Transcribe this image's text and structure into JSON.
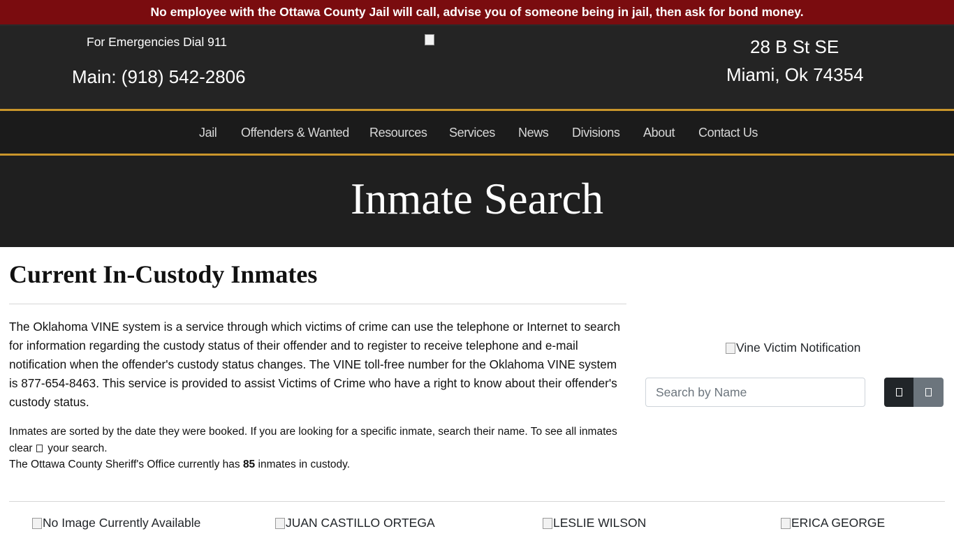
{
  "alert": {
    "text": "No employee with the Ottawa County Jail will call, advise you of someone being in jail, then ask for bond money."
  },
  "header": {
    "emergency": "For Emergencies Dial 911",
    "main_phone": "Main: (918) 542-2806",
    "address_line1": "28 B St SE",
    "address_line2": "Miami, Ok 74354"
  },
  "nav": {
    "items": [
      {
        "label": "Jail"
      },
      {
        "label": "Offenders & Wanted"
      },
      {
        "label": "Resources"
      },
      {
        "label": "Services"
      },
      {
        "label": "News"
      },
      {
        "label": "Divisions"
      },
      {
        "label": "About"
      },
      {
        "label": "Contact Us"
      }
    ]
  },
  "hero": {
    "title": "Inmate Search"
  },
  "main": {
    "section_title": "Current In-Custody Inmates",
    "vine_paragraph": "The Oklahoma VINE system is a service through which victims of crime can use the telephone or Internet to search for information regarding the custody status of their offender and to register to receive telephone and e-mail notification when the offender's custody status changes. The VINE toll-free number for the Oklahoma VINE system is 877-654-8463. This service is provided to assist Victims of Crime who have a right to know about their offender's custody status.",
    "sort_note_a": "Inmates are sorted by the date they were booked. If you are looking for a specific inmate, search their name. To see all inmates clear",
    "sort_note_b": "your search.",
    "count_prefix": "The Ottawa County Sheriff's Office currently has",
    "count": "85",
    "count_suffix": "inmates in custody."
  },
  "sidebar": {
    "vine_image_alt": "Vine Victim Notification",
    "search_placeholder": "Search by Name"
  },
  "inmates": [
    {
      "alt": "No Image Currently Available"
    },
    {
      "alt": "JUAN CASTILLO ORTEGA"
    },
    {
      "alt": "LESLIE WILSON"
    },
    {
      "alt": "ERICA GEORGE"
    }
  ],
  "colors": {
    "alert_bg": "#7a0c0f",
    "accent_gold": "#c9952b",
    "header_bg": "#242424"
  }
}
